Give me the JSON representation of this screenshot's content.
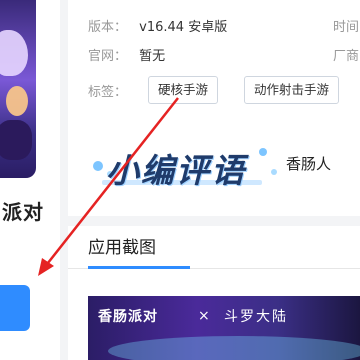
{
  "left": {
    "app_name": "派对",
    "download_button": ""
  },
  "info": {
    "version_label": "版本：",
    "version_value": "v16.44 安卓版",
    "site_label": "官网：",
    "site_value": "暂无",
    "tags_label": "标签：",
    "right_col_1": "时间",
    "right_col_2": "厂商"
  },
  "tags": [
    "硬核手游",
    "动作射击手游"
  ],
  "editor_review": {
    "title": "小编评语",
    "text": "香肠人"
  },
  "screenshots": {
    "title": "应用截图",
    "shot_text_1": "香肠派对",
    "shot_x": "×",
    "shot_text_2": "斗罗大陆"
  },
  "colors": {
    "accent": "#2f8cff",
    "arrow": "#e52323"
  }
}
